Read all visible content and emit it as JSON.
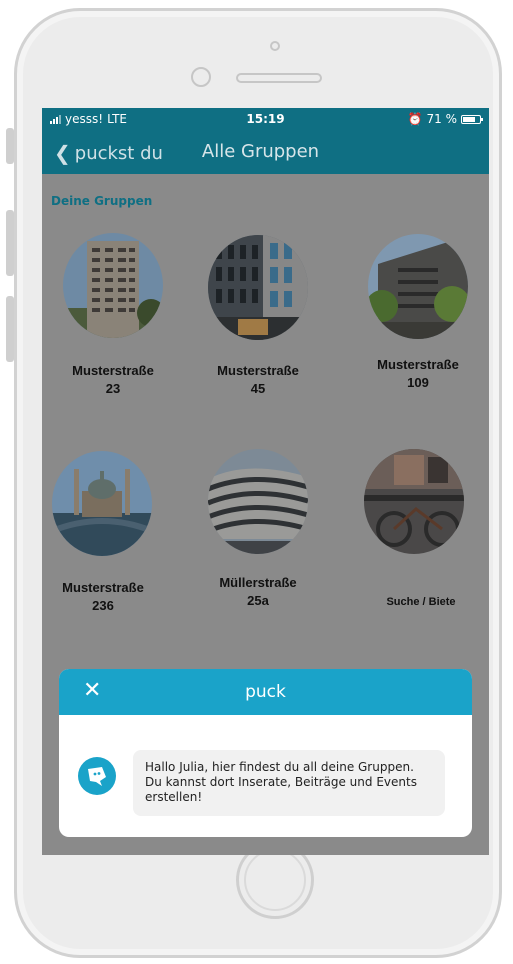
{
  "status_bar": {
    "carrier": "yesss!",
    "network": "LTE",
    "time": "15:19",
    "battery_percent": "71 %",
    "alarm_icon": "alarm-icon"
  },
  "nav": {
    "back_label": "puckst du",
    "title": "Alle Gruppen"
  },
  "section": {
    "title": "Deine Gruppen"
  },
  "groups": [
    {
      "line1": "Musterstraße",
      "line2": "23"
    },
    {
      "line1": "Musterstraße",
      "line2": "45"
    },
    {
      "line1": "Musterstraße",
      "line2": "109"
    },
    {
      "line1": "Musterstraße",
      "line2": "236"
    },
    {
      "line1": "Müllerstraße",
      "line2": "25a"
    },
    {
      "line1": "Suche / Biete",
      "line2": ""
    }
  ],
  "modal": {
    "title": "puck",
    "close_icon": "close-icon",
    "avatar_icon": "chat-bot-icon",
    "message": "Hallo Julia, hier findest du all deine Gruppen. Du kannst dort Inserate, Beiträge und Events erstellen!"
  },
  "colors": {
    "header": "#0f6f83",
    "accent": "#1aa3c9",
    "overlay": "#8a8a8a"
  }
}
